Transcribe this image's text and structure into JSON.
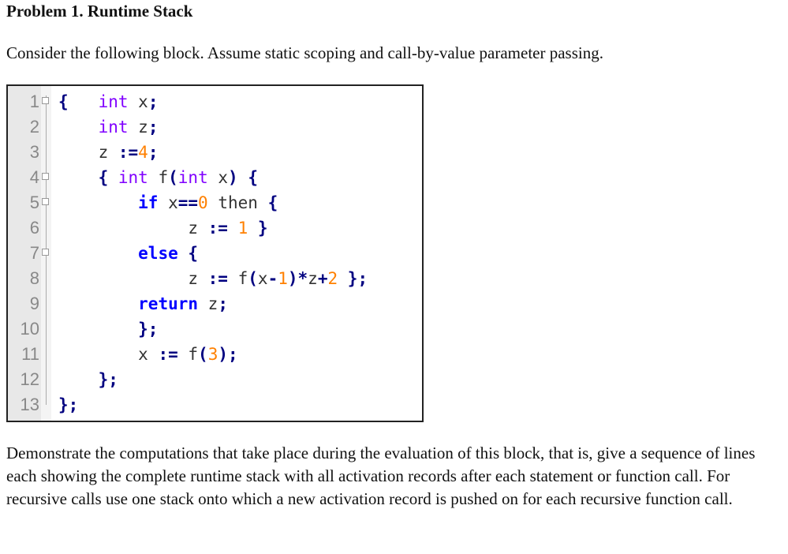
{
  "title": "Problem 1. Runtime Stack",
  "intro": "Consider the following block. Assume static scoping and call-by-value parameter passing.",
  "code": {
    "lines": [
      {
        "n": "1",
        "fold": true,
        "tokens": [
          {
            "t": "{",
            "c": "op"
          },
          {
            "t": "   ",
            "c": "id"
          },
          {
            "t": "int",
            "c": "kw"
          },
          {
            "t": " x",
            "c": "id"
          },
          {
            "t": ";",
            "c": "op"
          }
        ]
      },
      {
        "n": "2",
        "fold": false,
        "tokens": [
          {
            "t": "    ",
            "c": "id"
          },
          {
            "t": "int",
            "c": "kw"
          },
          {
            "t": " z",
            "c": "id"
          },
          {
            "t": ";",
            "c": "op"
          }
        ]
      },
      {
        "n": "3",
        "fold": false,
        "tokens": [
          {
            "t": "    z ",
            "c": "id"
          },
          {
            "t": ":=",
            "c": "op"
          },
          {
            "t": "4",
            "c": "num"
          },
          {
            "t": ";",
            "c": "op"
          }
        ]
      },
      {
        "n": "4",
        "fold": true,
        "tokens": [
          {
            "t": "    ",
            "c": "id"
          },
          {
            "t": "{",
            "c": "op"
          },
          {
            "t": " ",
            "c": "id"
          },
          {
            "t": "int",
            "c": "kw"
          },
          {
            "t": " f",
            "c": "id"
          },
          {
            "t": "(",
            "c": "op"
          },
          {
            "t": "int",
            "c": "kw"
          },
          {
            "t": " x",
            "c": "id"
          },
          {
            "t": ")",
            "c": "op"
          },
          {
            "t": " ",
            "c": "id"
          },
          {
            "t": "{",
            "c": "op"
          }
        ]
      },
      {
        "n": "5",
        "fold": true,
        "tokens": [
          {
            "t": "        ",
            "c": "id"
          },
          {
            "t": "if",
            "c": "key"
          },
          {
            "t": " x",
            "c": "id"
          },
          {
            "t": "==",
            "c": "op"
          },
          {
            "t": "0",
            "c": "num"
          },
          {
            "t": " then ",
            "c": "id"
          },
          {
            "t": "{",
            "c": "op"
          }
        ]
      },
      {
        "n": "6",
        "fold": false,
        "tokens": [
          {
            "t": "             z ",
            "c": "id"
          },
          {
            "t": ":=",
            "c": "op"
          },
          {
            "t": " ",
            "c": "id"
          },
          {
            "t": "1",
            "c": "num"
          },
          {
            "t": " ",
            "c": "id"
          },
          {
            "t": "}",
            "c": "op"
          }
        ]
      },
      {
        "n": "7",
        "fold": true,
        "tokens": [
          {
            "t": "        ",
            "c": "id"
          },
          {
            "t": "else",
            "c": "key"
          },
          {
            "t": " ",
            "c": "id"
          },
          {
            "t": "{",
            "c": "op"
          }
        ]
      },
      {
        "n": "8",
        "fold": false,
        "tokens": [
          {
            "t": "             z ",
            "c": "id"
          },
          {
            "t": ":=",
            "c": "op"
          },
          {
            "t": " f",
            "c": "id"
          },
          {
            "t": "(",
            "c": "op"
          },
          {
            "t": "x",
            "c": "id"
          },
          {
            "t": "-",
            "c": "op"
          },
          {
            "t": "1",
            "c": "num"
          },
          {
            "t": ")*",
            "c": "op"
          },
          {
            "t": "z",
            "c": "id"
          },
          {
            "t": "+",
            "c": "op"
          },
          {
            "t": "2",
            "c": "num"
          },
          {
            "t": " ",
            "c": "id"
          },
          {
            "t": "};",
            "c": "op"
          }
        ]
      },
      {
        "n": "9",
        "fold": false,
        "tokens": [
          {
            "t": "        ",
            "c": "id"
          },
          {
            "t": "return",
            "c": "key"
          },
          {
            "t": " z",
            "c": "id"
          },
          {
            "t": ";",
            "c": "op"
          }
        ]
      },
      {
        "n": "10",
        "fold": false,
        "tokens": [
          {
            "t": "        ",
            "c": "id"
          },
          {
            "t": "};",
            "c": "op"
          }
        ]
      },
      {
        "n": "11",
        "fold": false,
        "tokens": [
          {
            "t": "        x ",
            "c": "id"
          },
          {
            "t": ":=",
            "c": "op"
          },
          {
            "t": " f",
            "c": "id"
          },
          {
            "t": "(",
            "c": "op"
          },
          {
            "t": "3",
            "c": "num"
          },
          {
            "t": ");",
            "c": "op"
          }
        ]
      },
      {
        "n": "12",
        "fold": false,
        "tokens": [
          {
            "t": "    ",
            "c": "id"
          },
          {
            "t": "};",
            "c": "op"
          }
        ]
      },
      {
        "n": "13",
        "fold": false,
        "tokens": [
          {
            "t": "};",
            "c": "op"
          }
        ]
      }
    ],
    "colors": {
      "keyword_type": "#8000ff",
      "keyword": "#0000ff",
      "number": "#ff8000",
      "operator": "#000080",
      "identifier": "#333333"
    }
  },
  "outro": "Demonstrate the computations that take place during the evaluation of this block, that is, give a sequence of lines each showing the complete runtime stack with all activation records after each statement or function call.  For recursive calls use one stack onto which a new activation record is pushed on for each recursive function call."
}
